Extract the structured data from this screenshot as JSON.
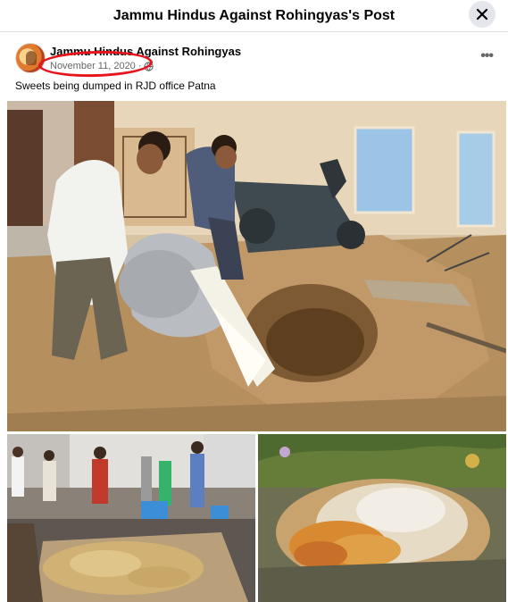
{
  "modal": {
    "title": "Jammu Hindus Against Rohingyas's Post",
    "close_icon": "close-icon"
  },
  "post": {
    "author": "Jammu Hindus Against Rohingyas",
    "date": "November 11, 2020",
    "separator": "·",
    "privacy_icon": "globe-icon",
    "more_label": "•••",
    "caption": "Sweets being dumped in RJD office Patna"
  },
  "annotation": {
    "highlight_color": "#e8141c"
  },
  "colors": {
    "header_border": "#dadde1",
    "close_bg": "#e4e6eb",
    "meta_text": "#65676b"
  }
}
